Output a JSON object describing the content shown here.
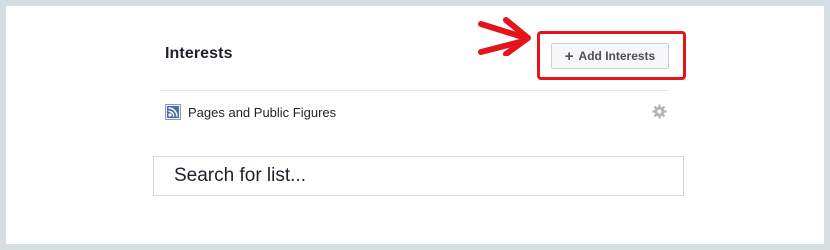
{
  "section": {
    "title": "Interests"
  },
  "add_button": {
    "label": "Add Interests",
    "icon": "plus-icon"
  },
  "annotation": {
    "arrow_icon": "arrow-right-icon",
    "highlight_color": "#e5141c"
  },
  "lists": [
    {
      "label": "Pages and Public Figures",
      "icon": "feed-icon",
      "action_icon": "gear-icon"
    }
  ],
  "search": {
    "placeholder": "Search for list..."
  }
}
